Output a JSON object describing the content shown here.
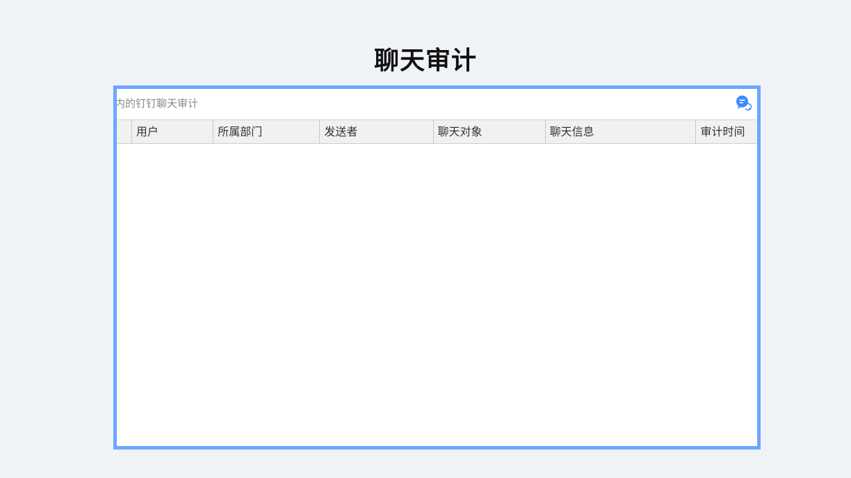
{
  "page": {
    "title": "聊天审计"
  },
  "toolbar": {
    "text": "内的钉钉聊天审计",
    "chat_icon": "chat-bubble-icon",
    "accent_color": "#3d8bff"
  },
  "frame": {
    "border_color": "#6ea6ff"
  },
  "table": {
    "columns": [
      "",
      "用户",
      "所属部门",
      "发送者",
      "聊天对象",
      "聊天信息",
      "审计时间"
    ],
    "rows": []
  }
}
